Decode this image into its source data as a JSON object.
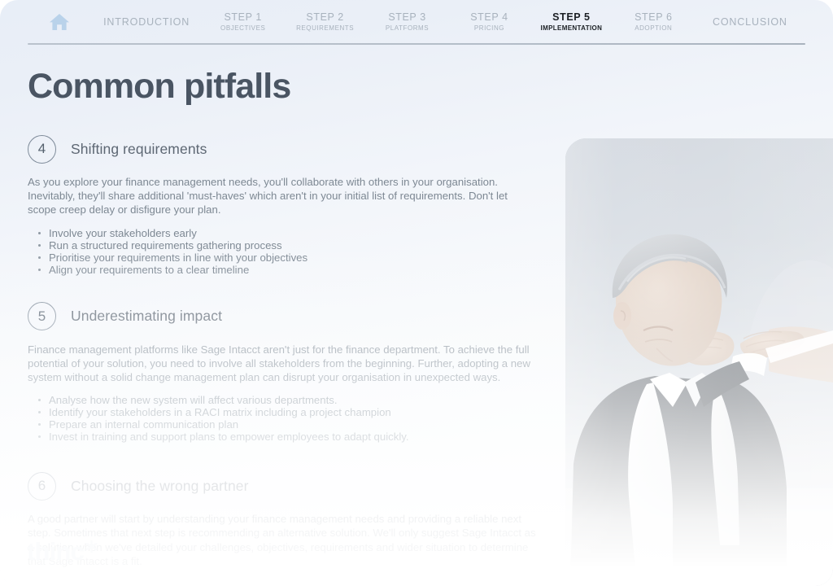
{
  "nav": {
    "home_icon": "home-icon",
    "items": [
      {
        "top": "INTRODUCTION",
        "sub": "",
        "active": false
      },
      {
        "top": "STEP 1",
        "sub": "OBJECTIVES",
        "active": false
      },
      {
        "top": "STEP 2",
        "sub": "REQUIREMENTS",
        "active": false
      },
      {
        "top": "STEP 3",
        "sub": "PLATFORMS",
        "active": false
      },
      {
        "top": "STEP 4",
        "sub": "PRICING",
        "active": false
      },
      {
        "top": "STEP 5",
        "sub": "IMPLEMENTATION",
        "active": true
      },
      {
        "top": "STEP 6",
        "sub": "ADOPTION",
        "active": false
      },
      {
        "top": "CONCLUSION",
        "sub": "",
        "active": false
      }
    ]
  },
  "header": {
    "title": "Common pitfalls"
  },
  "sections": [
    {
      "number": "4",
      "title": "Shifting requirements",
      "body": "As you explore your finance management needs, you'll collaborate with others in your organisation. Inevitably, they'll share additional 'must-haves' which aren't in your initial list of requirements. Don't let scope creep delay or disfigure your plan.",
      "bullets": [
        "Involve your stakeholders early",
        "Run a structured requirements gathering process",
        "Prioritise your requirements in line with your objectives",
        "Align your requirements to a clear timeline"
      ]
    },
    {
      "number": "5",
      "title": "Underestimating impact",
      "body": "Finance management platforms like Sage Intacct aren't just for the finance department. To achieve the full potential of your solution, you need to involve all stakeholders from the beginning. Further, adopting a new system without a solid change management plan can disrupt your organisation in unexpected ways.",
      "bullets": [
        "Analyse how the new system will affect various departments.",
        "Identify your stakeholders in a RACI matrix including a project champion",
        "Prepare an internal communication plan",
        "Invest in training and support plans to empower employees to adapt quickly."
      ]
    },
    {
      "number": "6",
      "title": "Choosing the wrong partner",
      "body": "A good partner will start by understanding your finance management needs and providing a reliable next step. Sometimes that next step is recommending an alternative solution. We'll only suggest Sage Intacct as a solution when we've detailed your challenges, objectives, requirements and wider situation to determine that Sage Intacct is a fit.",
      "bullets": []
    }
  ],
  "footer": {
    "logo_word": "thinc",
    "logo_mark": "asterisk-icon"
  },
  "media": {
    "photo_alt": "frustrated-businessman-photo"
  },
  "colors": {
    "page_background": "#eef2f8",
    "title": "#4a5563",
    "body_text": "#7d8893",
    "nav_inactive": "#a8b2bd",
    "nav_active": "#1b1f24",
    "home_icon": "#b9d2ea",
    "rule": "#b4bdc8",
    "logo": "#fbfcfd"
  }
}
